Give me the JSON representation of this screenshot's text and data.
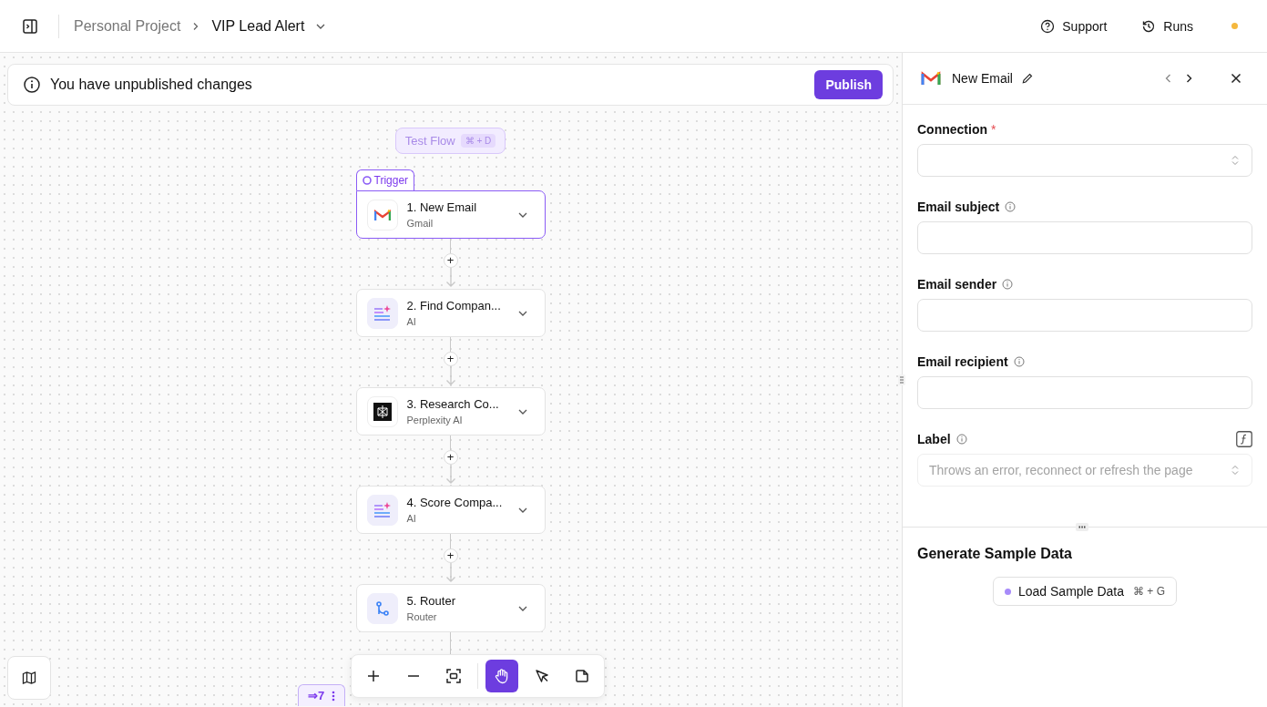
{
  "header": {
    "breadcrumb": "Personal Project",
    "flow_name": "VIP Lead Alert",
    "actions": [
      {
        "kind": "support",
        "label": "Support"
      },
      {
        "kind": "runs",
        "label": "Runs"
      }
    ]
  },
  "banner": {
    "text": "You have unpublished changes",
    "button": "Publish"
  },
  "test_flow": {
    "label": "Test Flow",
    "shortcut": "⌘ + D"
  },
  "steps": [
    {
      "title": "1. New Email",
      "subtitle": "Gmail",
      "kind": "gmail",
      "tag": "Trigger",
      "selected": true
    },
    {
      "add_button": "+",
      "title": "2. Find Compan...",
      "subtitle": "AI",
      "kind": "ai",
      "selected": false
    },
    {
      "add_button": "+",
      "title": "3. Research Co...",
      "subtitle": "Perplexity AI",
      "kind": "perplexity",
      "selected": false
    },
    {
      "add_button": "+",
      "title": "4. Score Compa...",
      "subtitle": "AI",
      "kind": "ai",
      "selected": false
    },
    {
      "add_button": "+",
      "title": "5. Router",
      "subtitle": "Router",
      "kind": "router",
      "selected": false
    }
  ],
  "branch_badge": "⇒7",
  "toolbar": [
    {
      "kind": "zoom-in",
      "selected": false
    },
    {
      "kind": "zoom-out",
      "selected": false
    },
    {
      "kind": "fit",
      "selected": false
    },
    {
      "kind": "hand",
      "selected": true
    },
    {
      "kind": "pointer",
      "selected": false
    },
    {
      "kind": "note",
      "selected": false
    }
  ],
  "panel": {
    "title": "New Email",
    "fields": [
      {
        "label": "Connection",
        "kind": "select",
        "required_mark": "*",
        "info": false,
        "formula": false,
        "disabled": false
      },
      {
        "label": "Email subject",
        "kind": "text",
        "info": true,
        "formula": false,
        "disabled": false
      },
      {
        "label": "Email sender",
        "kind": "text",
        "info": true,
        "formula": false,
        "disabled": false
      },
      {
        "label": "Email recipient",
        "kind": "text",
        "info": true,
        "formula": false,
        "disabled": false
      },
      {
        "label": "Label",
        "kind": "select",
        "info": true,
        "formula": true,
        "disabled": true,
        "placeholder": "Throws an error, reconnect or refresh the page"
      }
    ],
    "sample_title": "Generate Sample Data",
    "sample_button": "Load Sample Data",
    "sample_shortcut": "⌘ + G"
  }
}
